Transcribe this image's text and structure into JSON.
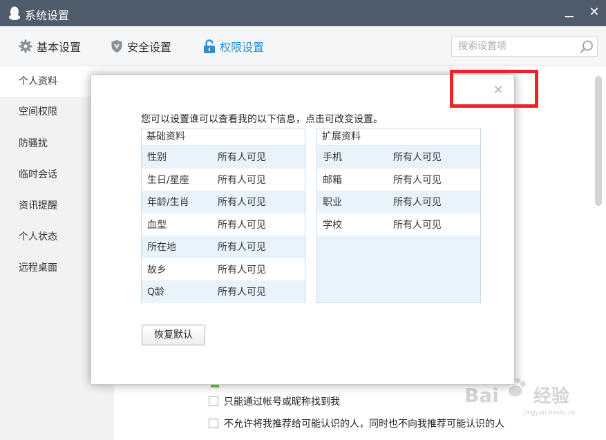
{
  "window": {
    "title": "系统设置",
    "minimize_icon": "minimize-icon",
    "close_label": "✕"
  },
  "tabs": [
    {
      "label": "基本设置",
      "icon": "gear-icon",
      "active": false
    },
    {
      "label": "安全设置",
      "icon": "shield-icon",
      "active": false
    },
    {
      "label": "权限设置",
      "icon": "lock-icon",
      "active": true
    }
  ],
  "search": {
    "placeholder": "搜索设置项",
    "value": ""
  },
  "sidebar": {
    "items": [
      {
        "label": "个人资料",
        "active": true
      },
      {
        "label": "空间权限"
      },
      {
        "label": "防骚扰"
      },
      {
        "label": "临时会话"
      },
      {
        "label": "资讯提醒"
      },
      {
        "label": "个人状态"
      },
      {
        "label": "远程桌面"
      }
    ]
  },
  "background_options": [
    {
      "label": "只能通过帐号或昵称找到我",
      "checked": false
    },
    {
      "label": "不允许将我推荐给可能认识的人，同时也不向我推荐可能认识的人",
      "checked": false
    }
  ],
  "dialog": {
    "close_label": "×",
    "description": "您可以设置谁可以查看我的以下信息，点击可改变设置。",
    "basic": {
      "header": "基础资料",
      "rows": [
        {
          "label": "性别",
          "value": "所有人可见"
        },
        {
          "label": "生日/星座",
          "value": "所有人可见"
        },
        {
          "label": "年龄/生肖",
          "value": "所有人可见"
        },
        {
          "label": "血型",
          "value": "所有人可见"
        },
        {
          "label": "所在地",
          "value": "所有人可见"
        },
        {
          "label": "故乡",
          "value": "所有人可见"
        },
        {
          "label": "Q龄",
          "value": "所有人可见"
        }
      ]
    },
    "extended": {
      "header": "扩展资料",
      "rows": [
        {
          "label": "手机",
          "value": "所有人可见"
        },
        {
          "label": "邮箱",
          "value": "所有人可见"
        },
        {
          "label": "职业",
          "value": "所有人可见"
        },
        {
          "label": "学校",
          "value": "所有人可见"
        }
      ]
    },
    "reset_label": "恢复默认"
  },
  "watermark": {
    "text": "Baidu经验",
    "url": "jingyan.baidu.com"
  },
  "colors": {
    "titlebar": "#4f5c6b",
    "accent": "#2a8fd8",
    "highlight": "#e8232a",
    "panel_bg": "#e8f3fb"
  }
}
